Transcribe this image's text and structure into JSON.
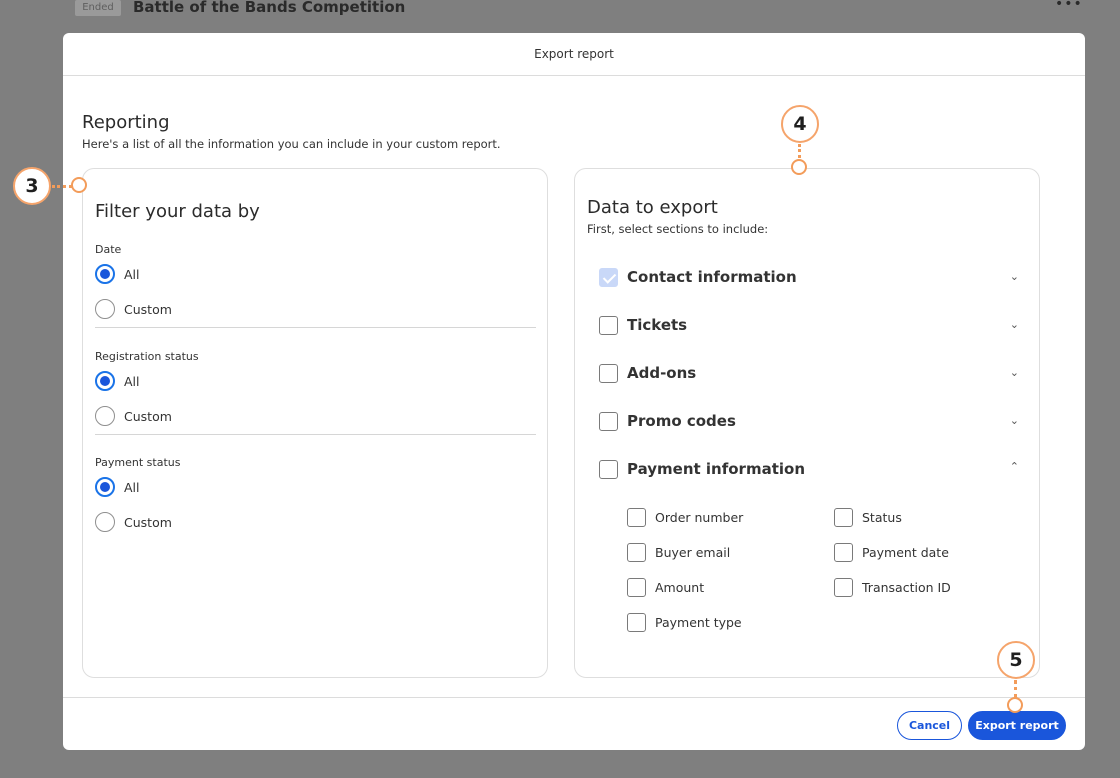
{
  "background": {
    "status_badge": "Ended",
    "event_title": "Battle of the Bands Competition",
    "more_icon": "more-horizontal-icon"
  },
  "modal": {
    "title": "Export report",
    "reporting_title": "Reporting",
    "reporting_subtitle": "Here's a list of all the information you can include in your custom report."
  },
  "filter": {
    "heading": "Filter your data by",
    "groups": [
      {
        "label": "Date",
        "options": [
          "All",
          "Custom"
        ],
        "selected": "All"
      },
      {
        "label": "Registration status",
        "options": [
          "All",
          "Custom"
        ],
        "selected": "All"
      },
      {
        "label": "Payment status",
        "options": [
          "All",
          "Custom"
        ],
        "selected": "All"
      }
    ]
  },
  "export": {
    "heading": "Data to export",
    "subtitle": "First, select sections to include:",
    "sections": [
      {
        "label": "Contact information",
        "checked": true,
        "expanded": false
      },
      {
        "label": "Tickets",
        "checked": false,
        "expanded": false
      },
      {
        "label": "Add-ons",
        "checked": false,
        "expanded": false
      },
      {
        "label": "Promo codes",
        "checked": false,
        "expanded": false
      },
      {
        "label": "Payment information",
        "checked": false,
        "expanded": true
      }
    ],
    "payment_fields": [
      "Order number",
      "Status",
      "Buyer email",
      "Payment date",
      "Amount",
      "Transaction ID",
      "Payment type"
    ]
  },
  "footer": {
    "cancel_label": "Cancel",
    "export_label": "Export report"
  },
  "annotations": [
    "3",
    "4",
    "5"
  ],
  "colors": {
    "accent": "#1a56db",
    "callout_border": "#f5a46b",
    "overlay": "#7f7f7f"
  }
}
